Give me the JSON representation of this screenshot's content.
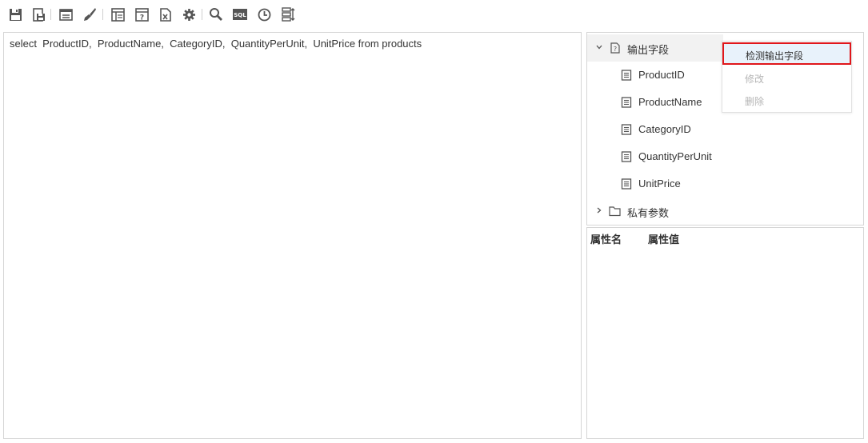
{
  "toolbar": {
    "buttons": [
      {
        "name": "save-icon"
      },
      {
        "name": "save-as-icon"
      },
      {
        "name": "window-icon"
      },
      {
        "name": "brush-icon"
      },
      {
        "name": "layout-icon"
      },
      {
        "name": "help-icon"
      },
      {
        "name": "excel-icon"
      },
      {
        "name": "gear-icon"
      },
      {
        "name": "search-icon"
      },
      {
        "name": "sql-icon",
        "label": "SQL"
      },
      {
        "name": "clock-icon"
      },
      {
        "name": "list-settings-icon"
      }
    ]
  },
  "editor": {
    "sql": "select  ProductID,  ProductName,  CategoryID,  QuantityPerUnit,  UnitPrice from products"
  },
  "tree": {
    "root_label": "输出字段",
    "fields": [
      "ProductID",
      "ProductName",
      "CategoryID",
      "QuantityPerUnit",
      "UnitPrice"
    ],
    "private_params_label": "私有参数"
  },
  "context_menu": {
    "items": [
      "检测输出字段",
      "修改",
      "删除"
    ]
  },
  "properties": {
    "col_name": "属性名",
    "col_value": "属性值"
  }
}
